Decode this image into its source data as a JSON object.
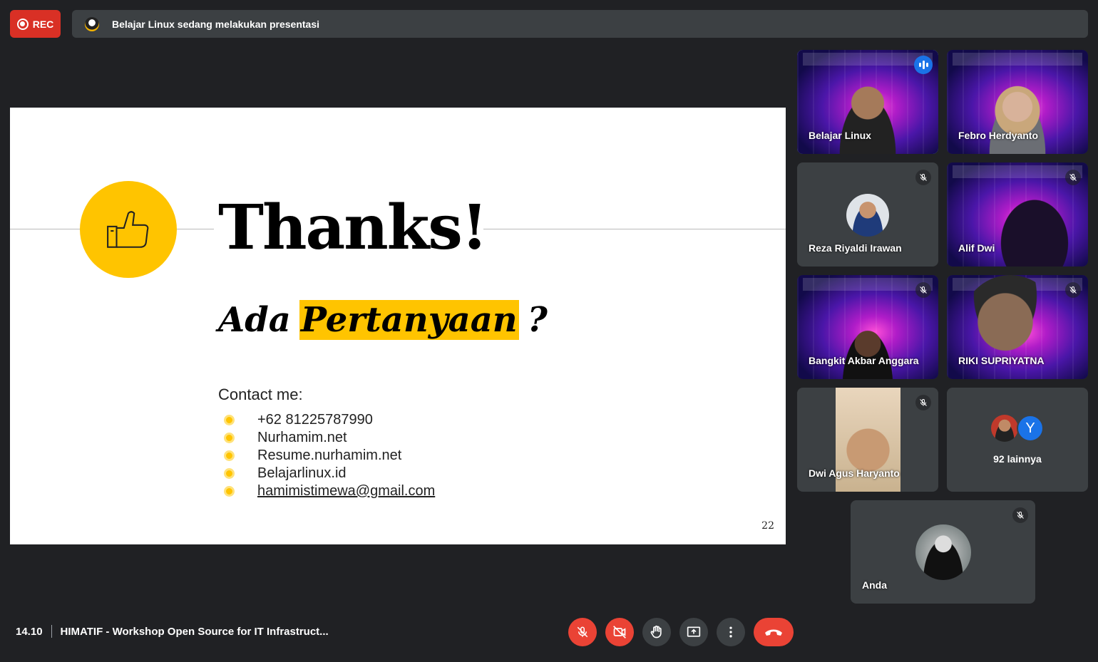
{
  "top_bar": {
    "rec_label": "REC",
    "presenting_text": "Belajar Linux sedang melakukan presentasi"
  },
  "slide": {
    "title": "Thanks!",
    "question_prefix": "Ada",
    "question_highlight": "Pertanyaan",
    "question_suffix": "?",
    "contact_title": "Contact me:",
    "contacts": [
      "+62 81225787990",
      "Nurhamim.net",
      "Resume.nurhamim.net",
      "Belajarlinux.id",
      "hamimistimewa@gmail.com"
    ],
    "page_number": "22",
    "accent_color": "#ffc400"
  },
  "participants": [
    {
      "name": "Belajar Linux",
      "status": "speaking"
    },
    {
      "name": "Febro Herdyanto",
      "status": "video"
    },
    {
      "name": "Reza Riyaldi Irawan",
      "status": "muted"
    },
    {
      "name": "Alif Dwi",
      "status": "muted"
    },
    {
      "name": "Bangkit Akbar Anggara",
      "status": "muted"
    },
    {
      "name": "RIKI SUPRIYATNA",
      "status": "muted"
    },
    {
      "name": "Dwi Agus Haryanto",
      "status": "muted"
    },
    {
      "name": "Anda",
      "status": "muted"
    }
  ],
  "more_participants": {
    "avatar_letter": "Y",
    "label": "92 lainnya"
  },
  "bottom_bar": {
    "time": "14.10",
    "meeting_title": "HIMATIF - Workshop Open Source for IT Infrastruct...",
    "controls": [
      "mic-off-icon",
      "camera-off-icon",
      "raise-hand-icon",
      "present-screen-icon",
      "more-options-icon",
      "end-call-icon"
    ]
  }
}
